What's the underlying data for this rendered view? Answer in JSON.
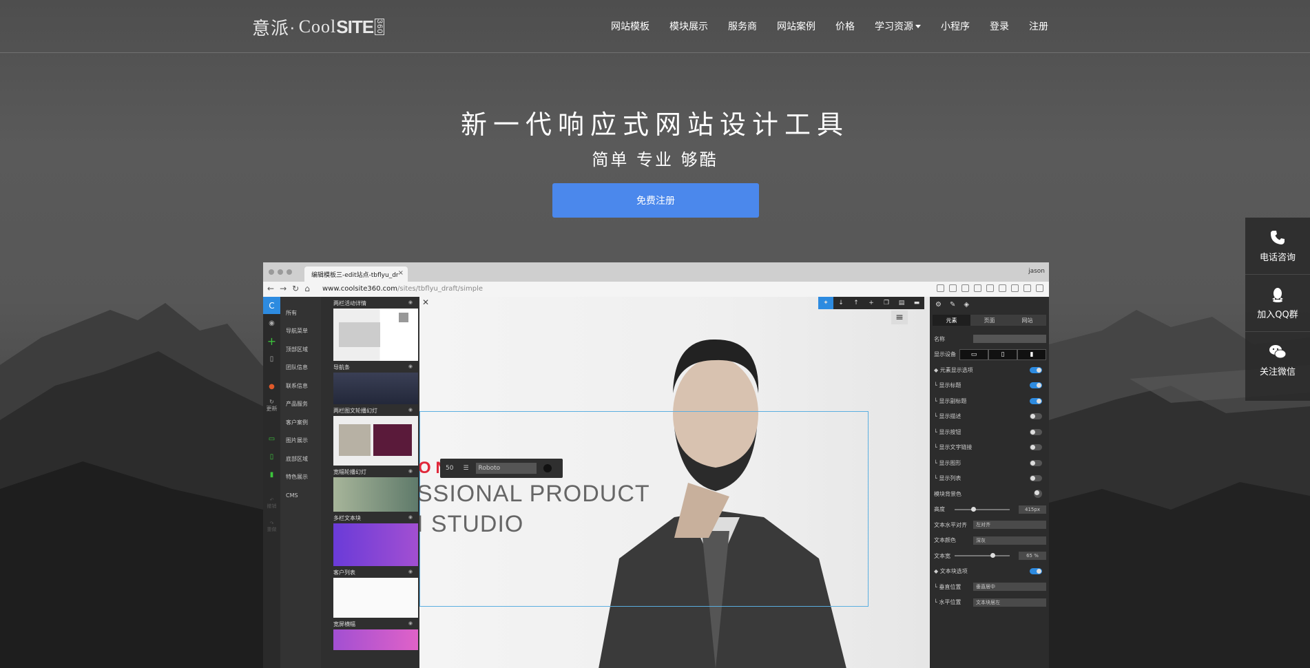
{
  "header": {
    "logo": {
      "cn": "意派",
      "dot": "·",
      "cool": "Cool",
      "site": "SITE",
      "n360": "360"
    },
    "nav": [
      {
        "label": "网站模板"
      },
      {
        "label": "模块展示"
      },
      {
        "label": "服务商"
      },
      {
        "label": "网站案例"
      },
      {
        "label": "价格"
      },
      {
        "label": "学习资源",
        "has_dropdown": true
      },
      {
        "label": "小程序"
      },
      {
        "label": "登录"
      },
      {
        "label": "注册"
      }
    ]
  },
  "hero": {
    "title": "新一代响应式网站设计工具",
    "subtitle": "简单 专业 够酷",
    "cta_label": "免费注册"
  },
  "float_bar": [
    {
      "label": "电话咨询",
      "icon": "phone-icon"
    },
    {
      "label": "加入QQ群",
      "icon": "qq-icon"
    },
    {
      "label": "关注微信",
      "icon": "wechat-icon"
    }
  ],
  "browser": {
    "tab_title": "编辑模板三-edit站点-tbflyu_dr",
    "user": "jason",
    "url_host": "www.coolsite360.com",
    "url_path": "/sites/tbflyu_draft/simple",
    "categories": [
      "所有",
      "导航菜单",
      "顶部区域",
      "团队信息",
      "联系信息",
      "产品服务",
      "客户案例",
      "图片展示",
      "底部区域",
      "特色展示",
      "CMS"
    ],
    "left_update": "更新",
    "left_undo": "撤销",
    "left_redo": "重做",
    "thumbs": [
      {
        "label": "两栏活动详情"
      },
      {
        "label": "导航条"
      },
      {
        "label": "两栏图文轮播幻灯"
      },
      {
        "label": "宽幅轮播幻灯"
      },
      {
        "label": "多栏文本块"
      },
      {
        "label": "客户列表"
      },
      {
        "label": "宽屏横幅"
      }
    ],
    "canvas": {
      "red_text": "O N",
      "line1": "SSIONAL PRODUCT",
      "line2": "I STUDIO",
      "font_size": "50",
      "font_name": "Roboto"
    },
    "right_panel": {
      "tabs": [
        "元素",
        "页面",
        "网站"
      ],
      "name_label": "名称",
      "device_label": "显示设备",
      "toggles": [
        {
          "label": "◆ 元素显示选项",
          "on": true
        },
        {
          "label": "└ 显示标题",
          "on": true
        },
        {
          "label": "└ 显示副标题",
          "on": true
        },
        {
          "label": "└ 显示描述",
          "on": false
        },
        {
          "label": "└ 显示按钮",
          "on": false
        },
        {
          "label": "└ 显示文字链接",
          "on": false
        },
        {
          "label": "└ 显示图形",
          "on": false
        },
        {
          "label": "└ 显示列表",
          "on": false
        }
      ],
      "bg_label": "模块背景色",
      "height_label": "高度",
      "height_value": "415px",
      "height_fraction": 0.3,
      "align_label": "文本水平对齐",
      "align_value": "左对齐",
      "color_label": "文本颜色",
      "color_value": "深灰",
      "width_label": "文本宽",
      "width_value": "65",
      "width_unit": "%",
      "width_fraction": 0.65,
      "block_label": "◆ 文本块选项",
      "vpos_label": "└ 垂直位置",
      "vpos_value": "垂直居中",
      "hpos_label": "└ 水平位置",
      "hpos_value": "文本块居左"
    }
  },
  "colors": {
    "accent": "#4b88ec",
    "editor_blue": "#2d8be0"
  }
}
